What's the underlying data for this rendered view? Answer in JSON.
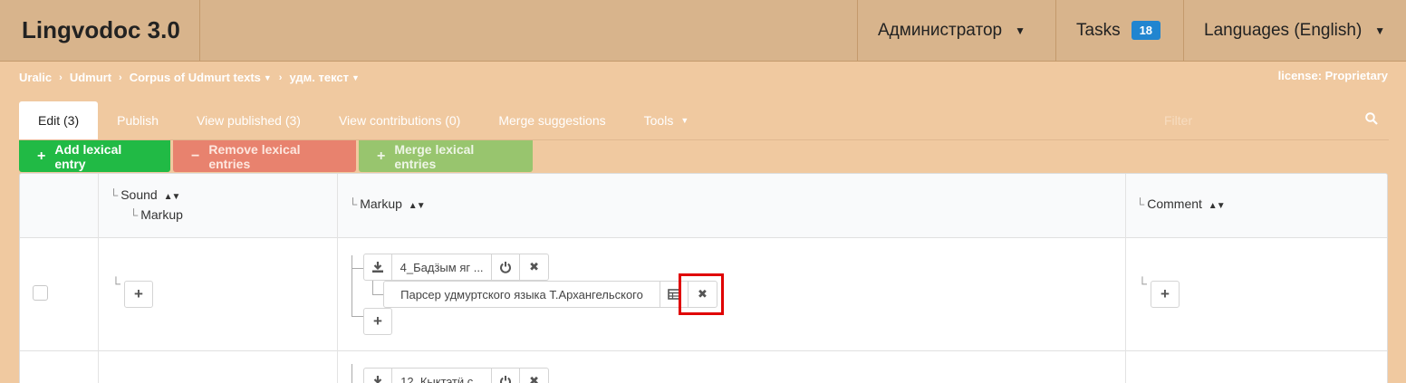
{
  "header": {
    "brand": "Lingvodoc 3.0",
    "user_menu": "Администратор",
    "tasks_label": "Tasks",
    "tasks_count": "18",
    "languages_menu": "Languages (English)"
  },
  "breadcrumbs": [
    "Uralic",
    "Udmurt",
    "Corpus of Udmurt texts",
    "удм. текст"
  ],
  "license": "license: Proprietary",
  "tabs": {
    "edit": "Edit (3)",
    "publish": "Publish",
    "view_published": "View published (3)",
    "view_contributions": "View contributions (0)",
    "merge_suggestions": "Merge suggestions",
    "tools": "Tools"
  },
  "filter": {
    "placeholder": "Filter"
  },
  "actions": {
    "add": "Add lexical entry",
    "remove": "Remove lexical entries",
    "merge": "Merge lexical entries"
  },
  "columns": {
    "sound": "Sound",
    "sound_markup": "Markup",
    "markup": "Markup",
    "comment": "Comment"
  },
  "rows": [
    {
      "sound_file": "4_Бадӟым яг ...",
      "markup_file": "Парсер удмуртского языка Т.Архангельского"
    },
    {
      "sound_file": "12_Кыктэтӥ с..."
    }
  ],
  "icons": {
    "download": "download-icon",
    "power": "power-icon",
    "close": "close-icon",
    "table": "table-icon",
    "plus": "plus-icon",
    "search": "search-icon"
  },
  "colors": {
    "background": "#f0c9a0",
    "topbar": "#d8b48c",
    "add_button": "#21ba45",
    "remove_button": "#e8826e",
    "merge_button": "#98c56e",
    "badge": "#2185d0",
    "highlight": "#e00000"
  }
}
